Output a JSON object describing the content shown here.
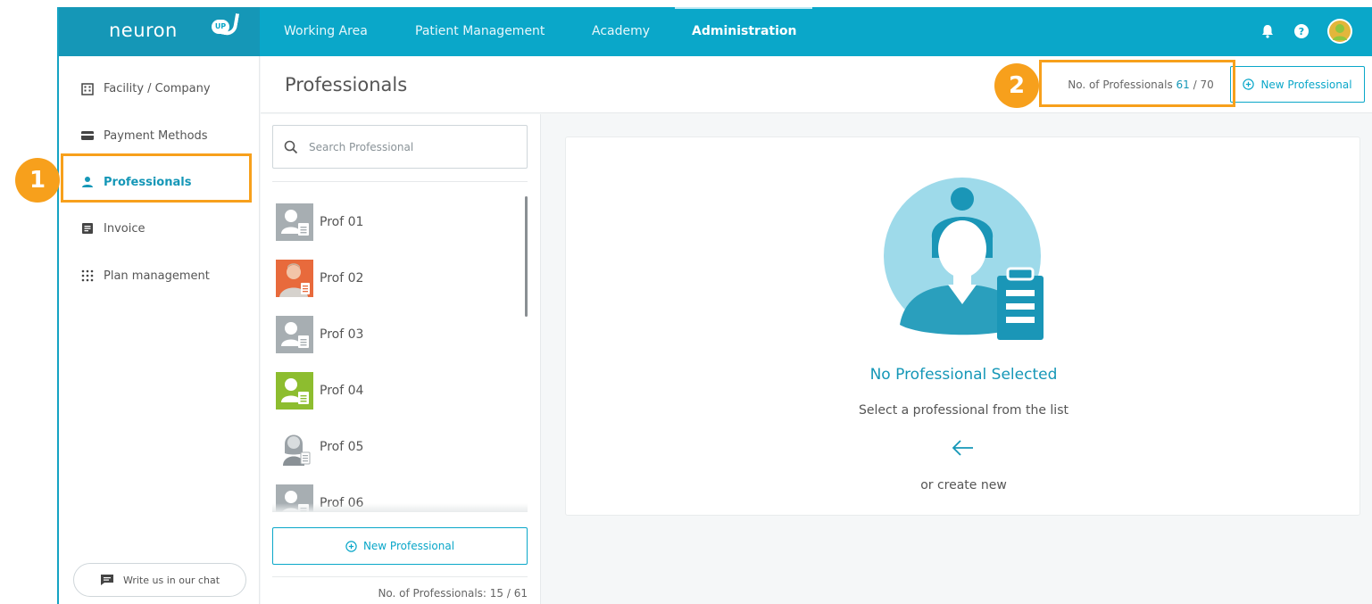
{
  "app": {
    "logo_text": "neuron",
    "logo_badge": "UP"
  },
  "nav": {
    "items": [
      {
        "label": "Working Area"
      },
      {
        "label": "Patient Management"
      },
      {
        "label": "Academy"
      },
      {
        "label": "Administration",
        "active": true
      }
    ]
  },
  "topbar_icons": [
    "bell-icon",
    "help-icon",
    "user-avatar"
  ],
  "sidebar": {
    "items": [
      {
        "label": "Facility / Company",
        "icon": "building-icon"
      },
      {
        "label": "Payment Methods",
        "icon": "credit-card-icon"
      },
      {
        "label": "Professionals",
        "icon": "person-icon",
        "active": true
      },
      {
        "label": "Invoice",
        "icon": "document-icon"
      },
      {
        "label": "Plan management",
        "icon": "grid-icon"
      }
    ],
    "chat_label": "Write us in our chat"
  },
  "header": {
    "title": "Professionals",
    "count_prefix": "No. of Professionals",
    "count_used": "61",
    "count_sep": " / ",
    "count_total": "70",
    "new_button": "New Professional"
  },
  "list": {
    "search_placeholder": "Search Professional",
    "professionals": [
      {
        "name": "Prof 01",
        "avatar": "default"
      },
      {
        "name": "Prof 02",
        "avatar": "photo-orange"
      },
      {
        "name": "Prof 03",
        "avatar": "default"
      },
      {
        "name": "Prof 04",
        "avatar": "default-green"
      },
      {
        "name": "Prof 05",
        "avatar": "photo-gray"
      },
      {
        "name": "Prof 06",
        "avatar": "default"
      }
    ],
    "new_button": "New Professional",
    "footer_count": "No. of Professionals: 15 / 61"
  },
  "detail": {
    "empty_title": "No Professional Selected",
    "empty_subtitle": "Select a professional from the list",
    "empty_create": "or create new"
  },
  "annotations": [
    {
      "label": "1"
    },
    {
      "label": "2"
    }
  ],
  "colors": {
    "brand": "#0aa7c9",
    "brand_dark": "#1597b7",
    "annotation": "#f7a01c",
    "illustration_bg": "#9edaea"
  }
}
